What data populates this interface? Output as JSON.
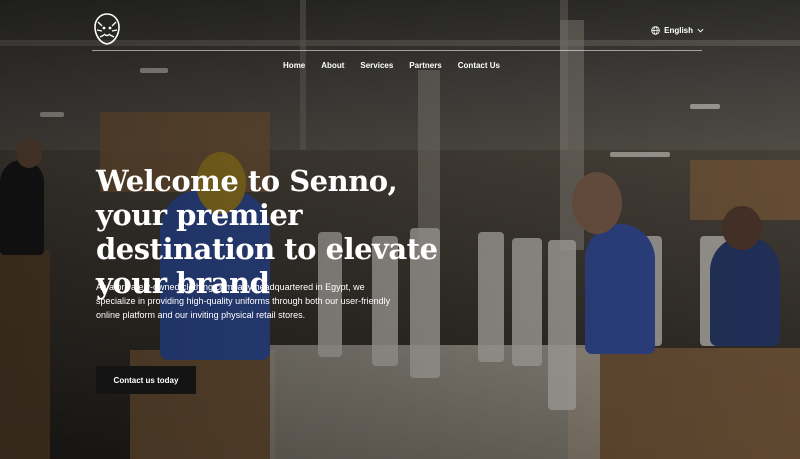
{
  "brand": {
    "logo_icon": "lion-head-icon"
  },
  "nav": {
    "items": [
      {
        "label": "Home"
      },
      {
        "label": "About"
      },
      {
        "label": "Services"
      },
      {
        "label": "Partners"
      },
      {
        "label": "Contact Us"
      }
    ]
  },
  "language": {
    "label": "English",
    "icon": "globe-icon",
    "caret_icon": "chevron-down-icon"
  },
  "hero": {
    "title": "Welcome to Senno, your premier destination to elevate your brand",
    "description": "As a privately-owned clothing company headquartered in Egypt, we specialize in providing high-quality uniforms through both our user-friendly online platform and our inviting physical retail stores.",
    "cta_label": "Contact us today"
  },
  "colors": {
    "cta_background": "#141414",
    "text": "#ffffff"
  }
}
